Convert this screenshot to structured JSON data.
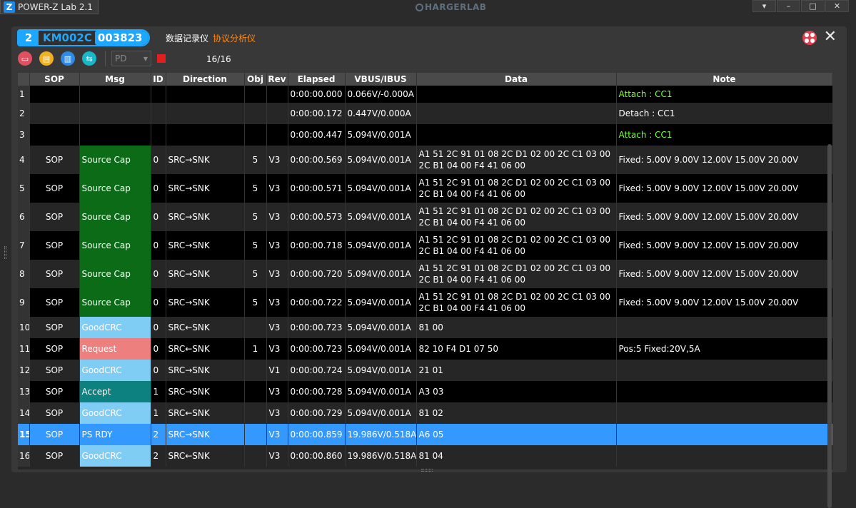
{
  "window": {
    "app_title": "POWER-Z Lab 2.1",
    "app_logo": "Z",
    "brand": "HARGERLAB",
    "controls": [
      "▾",
      "–",
      "□",
      "✕"
    ]
  },
  "device": {
    "index": "2",
    "model": "KM002C",
    "serial": "003823"
  },
  "mode_tabs": [
    "数据记录仪",
    "协议分析仪"
  ],
  "toolbar": {
    "protocol_select": "PD",
    "count": "16/16"
  },
  "columns": [
    "SOP",
    "Msg",
    "ID",
    "Direction",
    "Obj",
    "Rev",
    "Elapsed",
    "VBUS/IBUS",
    "Data",
    "Note"
  ],
  "rows": [
    {
      "n": "1",
      "sop": "",
      "msg": "",
      "msg_type": "",
      "id": "",
      "dir": "",
      "obj": "",
      "rev": "",
      "elapsed": "0:00:00.000",
      "vbus": "0.066V/-0.000A",
      "data1": "",
      "data2": "",
      "note": "Attach : CC1",
      "note_style": "green"
    },
    {
      "n": "2",
      "sop": "",
      "msg": "",
      "msg_type": "",
      "id": "",
      "dir": "",
      "obj": "",
      "rev": "",
      "elapsed": "0:00:00.172",
      "vbus": "0.447V/0.000A",
      "data1": "",
      "data2": "",
      "note": "Detach : CC1",
      "note_style": ""
    },
    {
      "n": "3",
      "sop": "",
      "msg": "",
      "msg_type": "",
      "id": "",
      "dir": "",
      "obj": "",
      "rev": "",
      "elapsed": "0:00:00.447",
      "vbus": "5.094V/0.001A",
      "data1": "",
      "data2": "",
      "note": "Attach : CC1",
      "note_style": "green"
    },
    {
      "n": "4",
      "sop": "SOP",
      "msg": "Source Cap",
      "msg_type": "srccap",
      "id": "0",
      "dir": "SRC→SNK",
      "obj": "5",
      "rev": "V3",
      "elapsed": "0:00:00.569",
      "vbus": "5.094V/0.001A",
      "data1": "A1 51 2C 91 01 08 2C D1 02 00 2C C1 03 00",
      "data2": "2C B1 04 00 F4 41 06 00",
      "note": "Fixed: 5.00V  9.00V  12.00V  15.00V  20.00V",
      "note_style": ""
    },
    {
      "n": "5",
      "sop": "SOP",
      "msg": "Source Cap",
      "msg_type": "srccap",
      "id": "0",
      "dir": "SRC→SNK",
      "obj": "5",
      "rev": "V3",
      "elapsed": "0:00:00.571",
      "vbus": "5.094V/0.001A",
      "data1": "A1 51 2C 91 01 08 2C D1 02 00 2C C1 03 00",
      "data2": "2C B1 04 00 F4 41 06 00",
      "note": "Fixed: 5.00V  9.00V  12.00V  15.00V  20.00V",
      "note_style": ""
    },
    {
      "n": "6",
      "sop": "SOP",
      "msg": "Source Cap",
      "msg_type": "srccap",
      "id": "0",
      "dir": "SRC→SNK",
      "obj": "5",
      "rev": "V3",
      "elapsed": "0:00:00.573",
      "vbus": "5.094V/0.001A",
      "data1": "A1 51 2C 91 01 08 2C D1 02 00 2C C1 03 00",
      "data2": "2C B1 04 00 F4 41 06 00",
      "note": "Fixed: 5.00V  9.00V  12.00V  15.00V  20.00V",
      "note_style": ""
    },
    {
      "n": "7",
      "sop": "SOP",
      "msg": "Source Cap",
      "msg_type": "srccap",
      "id": "0",
      "dir": "SRC→SNK",
      "obj": "5",
      "rev": "V3",
      "elapsed": "0:00:00.718",
      "vbus": "5.094V/0.001A",
      "data1": "A1 51 2C 91 01 08 2C D1 02 00 2C C1 03 00",
      "data2": "2C B1 04 00 F4 41 06 00",
      "note": "Fixed: 5.00V  9.00V  12.00V  15.00V  20.00V",
      "note_style": ""
    },
    {
      "n": "8",
      "sop": "SOP",
      "msg": "Source Cap",
      "msg_type": "srccap",
      "id": "0",
      "dir": "SRC→SNK",
      "obj": "5",
      "rev": "V3",
      "elapsed": "0:00:00.720",
      "vbus": "5.094V/0.001A",
      "data1": "A1 51 2C 91 01 08 2C D1 02 00 2C C1 03 00",
      "data2": "2C B1 04 00 F4 41 06 00",
      "note": "Fixed: 5.00V  9.00V  12.00V  15.00V  20.00V",
      "note_style": ""
    },
    {
      "n": "9",
      "sop": "SOP",
      "msg": "Source Cap",
      "msg_type": "srccap",
      "id": "0",
      "dir": "SRC→SNK",
      "obj": "5",
      "rev": "V3",
      "elapsed": "0:00:00.722",
      "vbus": "5.094V/0.001A",
      "data1": "A1 51 2C 91 01 08 2C D1 02 00 2C C1 03 00",
      "data2": "2C B1 04 00 F4 41 06 00",
      "note": "Fixed: 5.00V  9.00V  12.00V  15.00V  20.00V",
      "note_style": ""
    },
    {
      "n": "10",
      "sop": "SOP",
      "msg": "GoodCRC",
      "msg_type": "goodcrc",
      "id": "0",
      "dir": "SRC←SNK",
      "obj": "",
      "rev": "V3",
      "elapsed": "0:00:00.723",
      "vbus": "5.094V/0.001A",
      "data1": "81 00",
      "data2": "",
      "note": "",
      "note_style": ""
    },
    {
      "n": "11",
      "sop": "SOP",
      "msg": "Request",
      "msg_type": "request",
      "id": "0",
      "dir": "SRC←SNK",
      "obj": "1",
      "rev": "V3",
      "elapsed": "0:00:00.723",
      "vbus": "5.094V/0.001A",
      "data1": "82 10 F4 D1 07 50",
      "data2": "",
      "note": "Pos:5 Fixed:20V,5A",
      "note_style": ""
    },
    {
      "n": "12",
      "sop": "SOP",
      "msg": "GoodCRC",
      "msg_type": "goodcrc",
      "id": "0",
      "dir": "SRC→SNK",
      "obj": "",
      "rev": "V1",
      "elapsed": "0:00:00.724",
      "vbus": "5.094V/0.001A",
      "data1": "21 01",
      "data2": "",
      "note": "",
      "note_style": ""
    },
    {
      "n": "13",
      "sop": "SOP",
      "msg": "Accept",
      "msg_type": "accept",
      "id": "1",
      "dir": "SRC→SNK",
      "obj": "",
      "rev": "V3",
      "elapsed": "0:00:00.728",
      "vbus": "5.094V/0.001A",
      "data1": "A3 03",
      "data2": "",
      "note": "",
      "note_style": ""
    },
    {
      "n": "14",
      "sop": "SOP",
      "msg": "GoodCRC",
      "msg_type": "goodcrc",
      "id": "1",
      "dir": "SRC←SNK",
      "obj": "",
      "rev": "V3",
      "elapsed": "0:00:00.729",
      "vbus": "5.094V/0.001A",
      "data1": "81 02",
      "data2": "",
      "note": "",
      "note_style": ""
    },
    {
      "n": "15",
      "sop": "SOP",
      "msg": "PS RDY",
      "msg_type": "psrdy",
      "id": "2",
      "dir": "SRC→SNK",
      "obj": "",
      "rev": "V3",
      "elapsed": "0:00:00.859",
      "vbus": "19.986V/0.518A",
      "data1": "A6 05",
      "data2": "",
      "note": "",
      "note_style": "",
      "selected": true
    },
    {
      "n": "16",
      "sop": "SOP",
      "msg": "GoodCRC",
      "msg_type": "goodcrc",
      "id": "2",
      "dir": "SRC←SNK",
      "obj": "",
      "rev": "V3",
      "elapsed": "0:00:00.860",
      "vbus": "19.986V/0.518A",
      "data1": "81 04",
      "data2": "",
      "note": "",
      "note_style": ""
    }
  ],
  "colors": {
    "accent": "#1ea7ff",
    "source_cap": "#0b6b16",
    "goodcrc": "#7fccf5",
    "request": "#ee7f7f",
    "accept": "#0d8080",
    "selected_row": "#3399ff",
    "attach_note": "#7fff3f",
    "active_tab": "#ff8c1a"
  }
}
